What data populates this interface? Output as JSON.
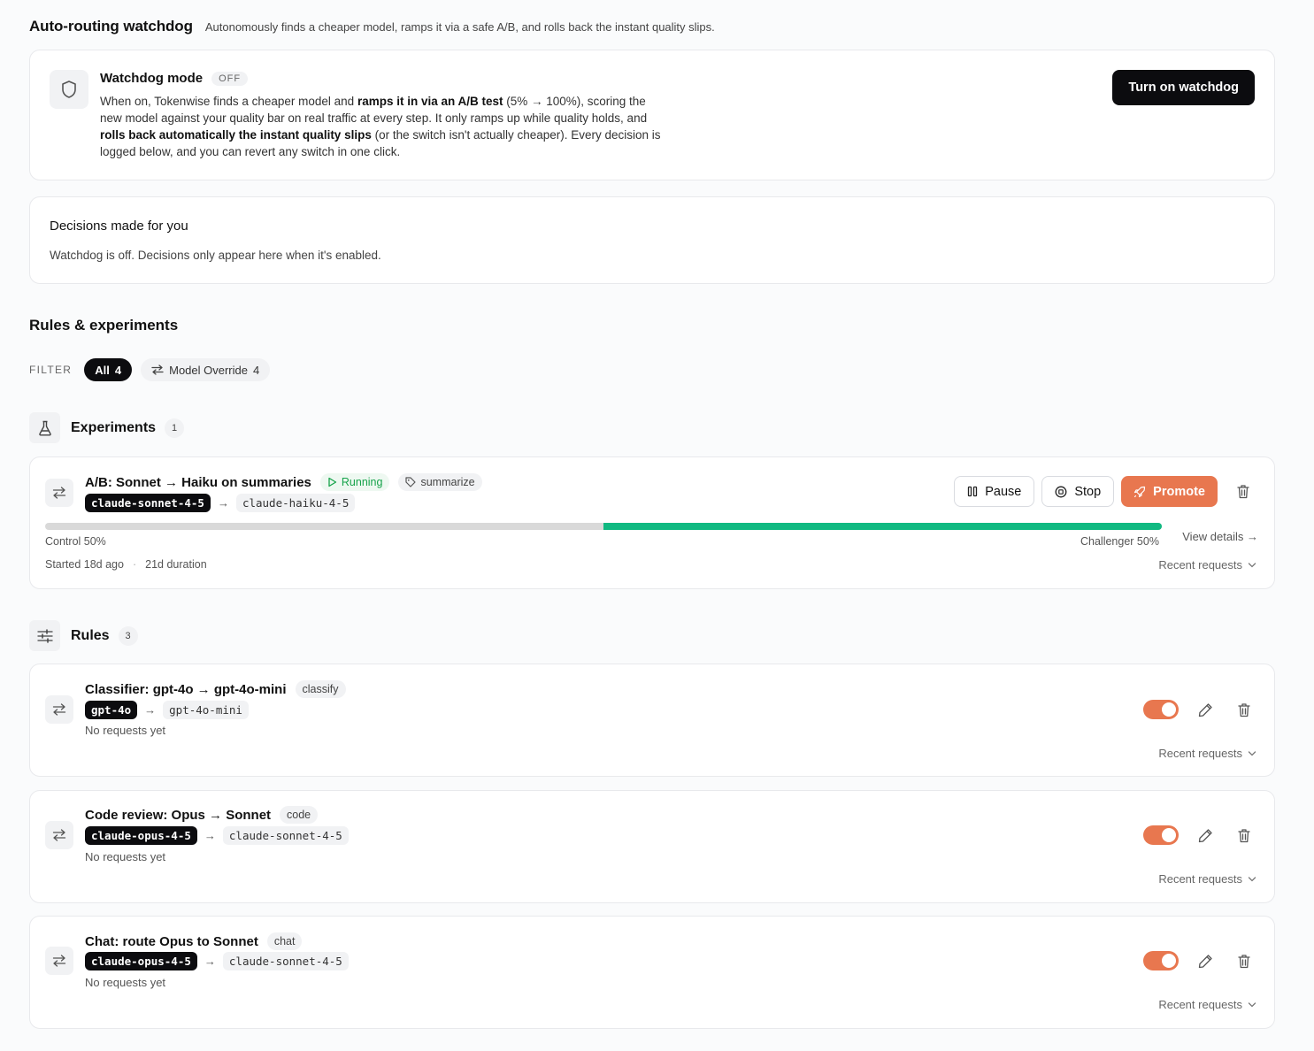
{
  "header": {
    "title": "Auto-routing watchdog",
    "description": "Autonomously finds a cheaper model, ramps it via a safe A/B, and rolls back the instant quality slips."
  },
  "watchdog": {
    "title": "Watchdog mode",
    "status": "OFF",
    "body_1": "When on, Tokenwise finds a cheaper model and ",
    "body_b1": "ramps it in via an A/B test",
    "body_2": " (5% → 100%), scoring the new model against your quality bar on real traffic at every step. It only ramps up while quality holds, and ",
    "body_b2": "rolls back automatically the instant quality slips",
    "body_3": " (or the switch isn't actually cheaper). Every decision is logged below, and you can revert any switch in one click.",
    "button": "Turn on watchdog"
  },
  "decisions": {
    "title": "Decisions made for you",
    "empty": "Watchdog is off. Decisions only appear here when it's enabled."
  },
  "rules_section": {
    "title": "Rules & experiments",
    "filter_label": "FILTER",
    "filters": [
      {
        "label": "All",
        "count": "4"
      },
      {
        "label": "Model Override",
        "count": "4"
      }
    ]
  },
  "experiments": {
    "title": "Experiments",
    "count": "1",
    "item": {
      "title": "A/B: Sonnet → Haiku on summaries",
      "status": "Running",
      "tag": "summarize",
      "from_model": "claude-sonnet-4-5",
      "to_model": "claude-haiku-4-5",
      "pause": "Pause",
      "stop": "Stop",
      "promote": "Promote",
      "control_label": "Control 50%",
      "challenger_label": "Challenger 50%",
      "challenger_fraction": 0.5,
      "view_details": "View details →",
      "started": "Started 18d ago",
      "separator": "·",
      "duration": "21d duration",
      "recent": "Recent requests"
    }
  },
  "rules": {
    "title": "Rules",
    "count": "3",
    "items": [
      {
        "title": "Classifier: gpt-4o → gpt-4o-mini",
        "tag": "classify",
        "from_model": "gpt-4o",
        "to_model": "gpt-4o-mini",
        "requests": "No requests yet",
        "recent": "Recent requests",
        "enabled": true
      },
      {
        "title": "Code review: Opus → Sonnet",
        "tag": "code",
        "from_model": "claude-opus-4-5",
        "to_model": "claude-sonnet-4-5",
        "requests": "No requests yet",
        "recent": "Recent requests",
        "enabled": true
      },
      {
        "title": "Chat: route Opus to Sonnet",
        "tag": "chat",
        "from_model": "claude-opus-4-5",
        "to_model": "claude-sonnet-4-5",
        "requests": "No requests yet",
        "recent": "Recent requests",
        "enabled": true
      }
    ]
  },
  "colors": {
    "accent": "#e8774f",
    "success": "#10b981",
    "dark": "#0c0c0f"
  }
}
